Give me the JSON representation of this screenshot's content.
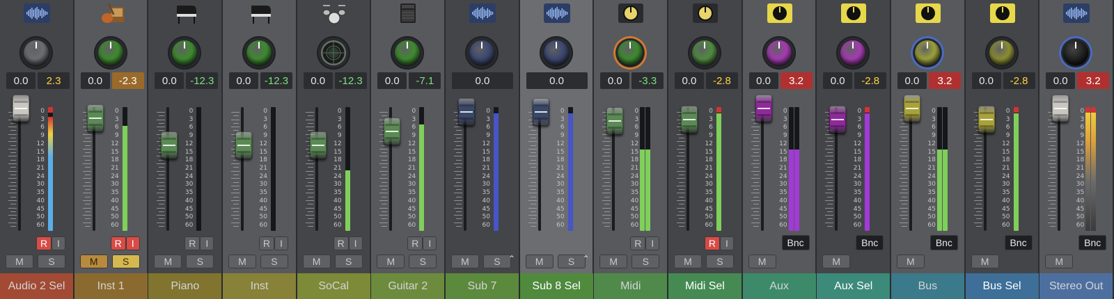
{
  "mixer": {
    "channels": [
      {
        "name": "Audio 2 Sel",
        "icon": "waveform-icon",
        "knob_color": "#6b6d70",
        "pan": "0.0",
        "vol": "2.3",
        "vol_color": "#ffd23f",
        "vol_bg": "#2c2d30",
        "fader_db": 3,
        "fader_color": "#c9c7c2",
        "meters": [
          {
            "level": 0.92,
            "fill": "#5aaee8",
            "clip": true
          }
        ],
        "rec": "R",
        "input": "I",
        "rec_on": true,
        "mute": "M",
        "solo": "S",
        "name_bg": "#a24a33",
        "strip": "dark"
      },
      {
        "name": "Inst 1",
        "icon": "guitar-icon",
        "knob_color": "#3d8a2e",
        "pan": "0.0",
        "vol": "-2.3",
        "vol_color": "#ffffff",
        "vol_bg": "#9a6a2a",
        "fader_db": -2.3,
        "fader_color": "#5b8a55",
        "meters": [
          {
            "level": 0.85,
            "fill": "#7fd05a",
            "clip": false
          }
        ],
        "rec": "R",
        "input": "I",
        "rec_on": true,
        "input_on": true,
        "mute": "M",
        "solo": "S",
        "mute_on": true,
        "solo_on": true,
        "name_bg": "#8a6a2e",
        "strip": "light"
      },
      {
        "name": "Piano",
        "icon": "grand-piano-icon",
        "knob_color": "#3d8a2e",
        "pan": "0.0",
        "vol": "-12.3",
        "vol_color": "#7ee07e",
        "vol_bg": "#2c2d30",
        "fader_db": -12.3,
        "fader_color": "#5b8a55",
        "meters": [
          {
            "level": 0.0,
            "fill": "#7fd05a",
            "clip": false
          }
        ],
        "rec": "R",
        "input": "I",
        "mute": "M",
        "solo": "S",
        "name_bg": "#80742f",
        "strip": "dark"
      },
      {
        "name": "Inst",
        "icon": "grand-piano-icon",
        "knob_color": "#3d8a2e",
        "pan": "0.0",
        "vol": "-12.3",
        "vol_color": "#7ee07e",
        "vol_bg": "#2c2d30",
        "fader_db": -12.3,
        "fader_color": "#5b8a55",
        "meters": [
          {
            "level": 0.0,
            "fill": "#7fd05a",
            "clip": false
          }
        ],
        "rec": "R",
        "input": "I",
        "mute": "M",
        "solo": "S",
        "name_bg": "#878238",
        "strip": "light"
      },
      {
        "name": "SoCal",
        "icon": "drum-kit-icon",
        "knob_color": "radar",
        "pan": "0.0",
        "vol": "-12.3",
        "vol_color": "#7ee07e",
        "vol_bg": "#2c2d30",
        "fader_db": -12.3,
        "fader_color": "#5b8a55",
        "meters": [
          {
            "level": 0.49,
            "fill": "#7fd05a",
            "clip": false
          }
        ],
        "rec": "R",
        "input": "I",
        "mute": "M",
        "solo": "S",
        "name_bg": "#7d8a38",
        "strip": "dark"
      },
      {
        "name": "Guitar 2",
        "icon": "amp-icon",
        "knob_color": "#3d8a2e",
        "pan": "0.0",
        "vol": "-7.1",
        "vol_color": "#7ee07e",
        "vol_bg": "#2c2d30",
        "fader_db": -7.1,
        "fader_color": "#5b8a55",
        "meters": [
          {
            "level": 0.86,
            "fill": "#7fd05a",
            "clip": false
          }
        ],
        "rec": "R",
        "input": "I",
        "mute": "M",
        "solo": "S",
        "name_bg": "#6d8b3c",
        "strip": "light"
      },
      {
        "name": "Sub 7",
        "icon": "waveform-icon",
        "knob_color": "#3c4870",
        "pan": "0.0",
        "vol": "",
        "vol_bg": "#2c2d30",
        "fader_db": 0,
        "fader_color": "#3a4868",
        "meters": [
          {
            "level": 0.95,
            "fill": "#4655c8",
            "clip": false
          }
        ],
        "mute": "M",
        "solo": "S",
        "name_bg": "#5c8a3c",
        "strip": "dark",
        "arrow": true
      },
      {
        "name": "Sub 8 Sel",
        "icon": "waveform-icon",
        "knob_color": "#3c4870",
        "pan": "0.0",
        "vol": "",
        "vol_bg": "#2c2d30",
        "fader_db": 0,
        "fader_color": "#3a4868",
        "meters": [
          {
            "level": 0.95,
            "fill": "#4655c8",
            "clip": false
          }
        ],
        "mute": "M",
        "solo": "S",
        "name_bg": "#4f8a3d",
        "strip": "hl",
        "arrow": true,
        "selected": true
      },
      {
        "name": "Midi",
        "icon": "clock-knob-icon",
        "knob_color": "#3d8a2e",
        "knob_ring": "#d27a34",
        "pan": "0.0",
        "vol": "-3.3",
        "vol_color": "#7ee07e",
        "vol_bg": "#2c2d30",
        "fader_db": -3.3,
        "fader_color": "#5b8a55",
        "meters": [
          {
            "level": 0.66,
            "fill": "#7fd05a",
            "clip": false
          },
          {
            "level": 0.66,
            "fill": "#7fd05a",
            "clip": false
          }
        ],
        "rec": "R",
        "input": "I",
        "mute": "M",
        "solo": "S",
        "name_bg": "#4f8a4a",
        "strip": "light"
      },
      {
        "name": "Midi Sel",
        "icon": "clock-knob-icon",
        "knob_color": "#4f8a40",
        "pan": "0.0",
        "vol": "-2.8",
        "vol_color": "#ffd23f",
        "vol_bg": "#2c2d30",
        "fader_db": -2.8,
        "fader_color": "#5b8a55",
        "meters": [
          {
            "level": 0.95,
            "fill": "#7fd05a",
            "clip": true
          }
        ],
        "rec": "R",
        "input": "I",
        "rec_on": true,
        "mute": "M",
        "solo": "S",
        "name_bg": "#448a52",
        "strip": "dark",
        "selected": true
      },
      {
        "name": "Aux",
        "icon": "yellow-knob-icon",
        "knob_color": "#a53ab0",
        "pan": "0.0",
        "vol": "3.2",
        "vol_color": "#ffffff",
        "vol_bg": "#b03030",
        "fader_db": 3.2,
        "fader_color": "#8e2a9a",
        "meters": [
          {
            "level": 0.66,
            "fill": "#a23ad8",
            "clip": false
          },
          {
            "level": 0.66,
            "fill": "#a23ad8",
            "clip": false
          }
        ],
        "bnc": "Bnc",
        "mute": "M",
        "name_bg": "#3d8a6a",
        "strip": "light"
      },
      {
        "name": "Aux Sel",
        "icon": "yellow-knob-icon",
        "knob_color": "#a53ab0",
        "pan": "0.0",
        "vol": "-2.8",
        "vol_color": "#ffd23f",
        "vol_bg": "#2c2d30",
        "fader_db": -2.8,
        "fader_color": "#8e2a9a",
        "meters": [
          {
            "level": 0.95,
            "fill": "#a23ad8",
            "clip": true
          }
        ],
        "bnc": "Bnc",
        "mute": "M",
        "name_bg": "#3c8a7a",
        "strip": "dark",
        "selected": true
      },
      {
        "name": "Bus",
        "icon": "yellow-knob-icon",
        "knob_color": "#9aa03a",
        "knob_ring": "#4b6cc0",
        "pan": "0.0",
        "vol": "3.2",
        "vol_color": "#ffffff",
        "vol_bg": "#b03030",
        "fader_db": 3.2,
        "fader_color": "#a8a23a",
        "meters": [
          {
            "level": 0.66,
            "fill": "#7fd05a",
            "clip": false
          },
          {
            "level": 0.66,
            "fill": "#7fd05a",
            "clip": false
          }
        ],
        "bnc": "Bnc",
        "mute": "M",
        "name_bg": "#3a7a8a",
        "strip": "light"
      },
      {
        "name": "Bus Sel",
        "icon": "yellow-knob-icon",
        "knob_color": "#8a8c32",
        "pan": "0.0",
        "vol": "-2.8",
        "vol_color": "#ffd23f",
        "vol_bg": "#2c2d30",
        "fader_db": -2.8,
        "fader_color": "#a8a23a",
        "meters": [
          {
            "level": 0.95,
            "fill": "#7fd05a",
            "clip": true
          }
        ],
        "bnc": "Bnc",
        "mute": "M",
        "name_bg": "#3d6f98",
        "strip": "dark",
        "selected": true
      },
      {
        "name": "Stereo Out",
        "icon": "waveform-icon",
        "knob_color": "#2a2b2e",
        "knob_ring": "#4b6cc0",
        "pan": "0.0",
        "vol": "3.2",
        "vol_color": "#ffffff",
        "vol_bg": "#b03030",
        "fader_db": 3.2,
        "fader_color": "#c9c7c2",
        "meters": [
          {
            "level": 0.98,
            "fill": "#e0a23a",
            "clip": true
          },
          {
            "level": 0.98,
            "fill": "#e0a23a",
            "clip": true
          }
        ],
        "bnc": "Bnc",
        "mute": "M",
        "name_bg": "#4d6fa0",
        "strip": "light"
      }
    ],
    "scale_labels": [
      "0",
      "3",
      "6",
      "9",
      "12",
      "15",
      "18",
      "21",
      "24",
      "30",
      "35",
      "40",
      "45",
      "50",
      "60"
    ]
  }
}
